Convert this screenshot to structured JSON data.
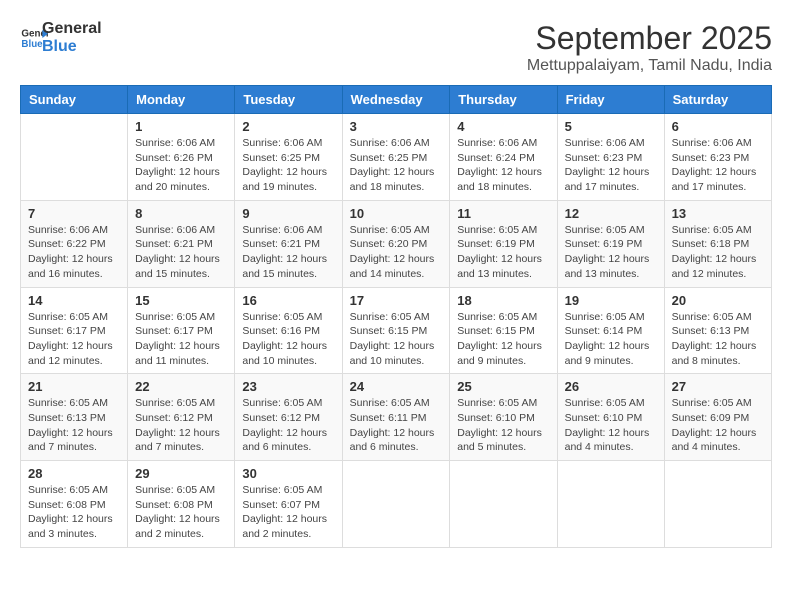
{
  "logo": {
    "line1": "General",
    "line2": "Blue",
    "icon": "▶"
  },
  "title": "September 2025",
  "subtitle": "Mettuppalaiyam, Tamil Nadu, India",
  "weekdays": [
    "Sunday",
    "Monday",
    "Tuesday",
    "Wednesday",
    "Thursday",
    "Friday",
    "Saturday"
  ],
  "weeks": [
    [
      {
        "day": "",
        "info": ""
      },
      {
        "day": "1",
        "info": "Sunrise: 6:06 AM\nSunset: 6:26 PM\nDaylight: 12 hours\nand 20 minutes."
      },
      {
        "day": "2",
        "info": "Sunrise: 6:06 AM\nSunset: 6:25 PM\nDaylight: 12 hours\nand 19 minutes."
      },
      {
        "day": "3",
        "info": "Sunrise: 6:06 AM\nSunset: 6:25 PM\nDaylight: 12 hours\nand 18 minutes."
      },
      {
        "day": "4",
        "info": "Sunrise: 6:06 AM\nSunset: 6:24 PM\nDaylight: 12 hours\nand 18 minutes."
      },
      {
        "day": "5",
        "info": "Sunrise: 6:06 AM\nSunset: 6:23 PM\nDaylight: 12 hours\nand 17 minutes."
      },
      {
        "day": "6",
        "info": "Sunrise: 6:06 AM\nSunset: 6:23 PM\nDaylight: 12 hours\nand 17 minutes."
      }
    ],
    [
      {
        "day": "7",
        "info": "Sunrise: 6:06 AM\nSunset: 6:22 PM\nDaylight: 12 hours\nand 16 minutes."
      },
      {
        "day": "8",
        "info": "Sunrise: 6:06 AM\nSunset: 6:21 PM\nDaylight: 12 hours\nand 15 minutes."
      },
      {
        "day": "9",
        "info": "Sunrise: 6:06 AM\nSunset: 6:21 PM\nDaylight: 12 hours\nand 15 minutes."
      },
      {
        "day": "10",
        "info": "Sunrise: 6:05 AM\nSunset: 6:20 PM\nDaylight: 12 hours\nand 14 minutes."
      },
      {
        "day": "11",
        "info": "Sunrise: 6:05 AM\nSunset: 6:19 PM\nDaylight: 12 hours\nand 13 minutes."
      },
      {
        "day": "12",
        "info": "Sunrise: 6:05 AM\nSunset: 6:19 PM\nDaylight: 12 hours\nand 13 minutes."
      },
      {
        "day": "13",
        "info": "Sunrise: 6:05 AM\nSunset: 6:18 PM\nDaylight: 12 hours\nand 12 minutes."
      }
    ],
    [
      {
        "day": "14",
        "info": "Sunrise: 6:05 AM\nSunset: 6:17 PM\nDaylight: 12 hours\nand 12 minutes."
      },
      {
        "day": "15",
        "info": "Sunrise: 6:05 AM\nSunset: 6:17 PM\nDaylight: 12 hours\nand 11 minutes."
      },
      {
        "day": "16",
        "info": "Sunrise: 6:05 AM\nSunset: 6:16 PM\nDaylight: 12 hours\nand 10 minutes."
      },
      {
        "day": "17",
        "info": "Sunrise: 6:05 AM\nSunset: 6:15 PM\nDaylight: 12 hours\nand 10 minutes."
      },
      {
        "day": "18",
        "info": "Sunrise: 6:05 AM\nSunset: 6:15 PM\nDaylight: 12 hours\nand 9 minutes."
      },
      {
        "day": "19",
        "info": "Sunrise: 6:05 AM\nSunset: 6:14 PM\nDaylight: 12 hours\nand 9 minutes."
      },
      {
        "day": "20",
        "info": "Sunrise: 6:05 AM\nSunset: 6:13 PM\nDaylight: 12 hours\nand 8 minutes."
      }
    ],
    [
      {
        "day": "21",
        "info": "Sunrise: 6:05 AM\nSunset: 6:13 PM\nDaylight: 12 hours\nand 7 minutes."
      },
      {
        "day": "22",
        "info": "Sunrise: 6:05 AM\nSunset: 6:12 PM\nDaylight: 12 hours\nand 7 minutes."
      },
      {
        "day": "23",
        "info": "Sunrise: 6:05 AM\nSunset: 6:12 PM\nDaylight: 12 hours\nand 6 minutes."
      },
      {
        "day": "24",
        "info": "Sunrise: 6:05 AM\nSunset: 6:11 PM\nDaylight: 12 hours\nand 6 minutes."
      },
      {
        "day": "25",
        "info": "Sunrise: 6:05 AM\nSunset: 6:10 PM\nDaylight: 12 hours\nand 5 minutes."
      },
      {
        "day": "26",
        "info": "Sunrise: 6:05 AM\nSunset: 6:10 PM\nDaylight: 12 hours\nand 4 minutes."
      },
      {
        "day": "27",
        "info": "Sunrise: 6:05 AM\nSunset: 6:09 PM\nDaylight: 12 hours\nand 4 minutes."
      }
    ],
    [
      {
        "day": "28",
        "info": "Sunrise: 6:05 AM\nSunset: 6:08 PM\nDaylight: 12 hours\nand 3 minutes."
      },
      {
        "day": "29",
        "info": "Sunrise: 6:05 AM\nSunset: 6:08 PM\nDaylight: 12 hours\nand 2 minutes."
      },
      {
        "day": "30",
        "info": "Sunrise: 6:05 AM\nSunset: 6:07 PM\nDaylight: 12 hours\nand 2 minutes."
      },
      {
        "day": "",
        "info": ""
      },
      {
        "day": "",
        "info": ""
      },
      {
        "day": "",
        "info": ""
      },
      {
        "day": "",
        "info": ""
      }
    ]
  ]
}
